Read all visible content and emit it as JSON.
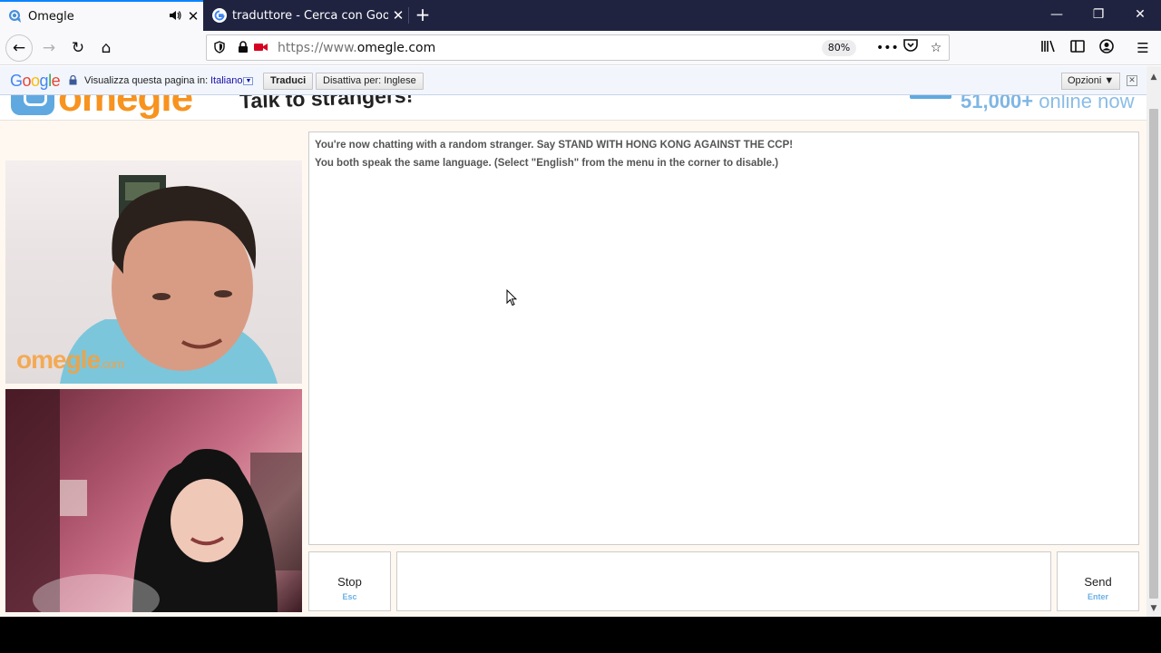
{
  "browser": {
    "tabs": [
      {
        "title": "Omegle",
        "active": true,
        "icon": "omegle-icon",
        "audio": "speaker-icon"
      },
      {
        "title": "traduttore - Cerca con Google",
        "active": false,
        "icon": "google-icon"
      }
    ],
    "newtab_label": "+",
    "window_controls": {
      "minimize": "—",
      "restore": "❐",
      "close": "✕"
    },
    "url_prefix": "https://www.",
    "url_domain": "omegle.com",
    "zoom": "80%",
    "nav_icons": {
      "back": "←",
      "forward": "→",
      "reload": "↻",
      "home": "⌂"
    }
  },
  "translate_bar": {
    "logo": {
      "G": "G",
      "o1": "o",
      "o2": "o",
      "g": "g",
      "l": "l",
      "e": "e"
    },
    "prompt": "Visualizza questa pagina in:",
    "language": "Italiano",
    "translate_button": "Traduci",
    "disable_button": "Disattiva per: Inglese",
    "options_button": "Opzioni ▼",
    "close": "✕"
  },
  "omegle": {
    "logo": "omegle",
    "tagline": "Talk to strangers!",
    "online_count": "51,000+",
    "online_label": "online now",
    "watermark": "omegle",
    "watermark_suffix": ".com",
    "chat_messages": [
      "You're now chatting with a random stranger. Say STAND WITH HONG KONG AGAINST THE CCP!",
      "You both speak the same language. (Select \"English\" from the menu in the corner to disable.)"
    ],
    "stop": {
      "label": "Stop",
      "key": "Esc"
    },
    "send": {
      "label": "Send",
      "key": "Enter"
    },
    "message_value": ""
  },
  "colors": {
    "accent": "#0a84ff",
    "omegle_orange": "#f7931e",
    "omegle_blue": "#6ab0e6",
    "tabbar": "#202340"
  }
}
